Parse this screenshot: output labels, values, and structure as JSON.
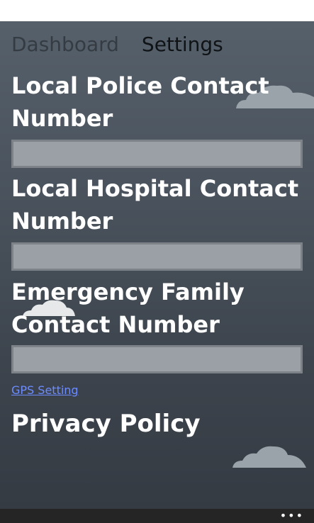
{
  "pivot": {
    "tabs": [
      {
        "label": "Dashboard"
      },
      {
        "label": "Settings"
      }
    ]
  },
  "form": {
    "police_label": "Local Police Contact Number",
    "hospital_label": "Local Hospital Contact Number",
    "family_label": "Emergency Family Contact Number",
    "police_value": "",
    "hospital_value": "",
    "family_value": ""
  },
  "links": {
    "gps_setting": "GPS Setting"
  },
  "privacy": {
    "label": "Privacy Policy"
  },
  "appbar": {
    "more": "•••"
  },
  "colors": {
    "background_top": "#56606a",
    "background_bottom": "#353b43",
    "input_fill": "#9aa0a6",
    "link": "#6c8cff"
  }
}
